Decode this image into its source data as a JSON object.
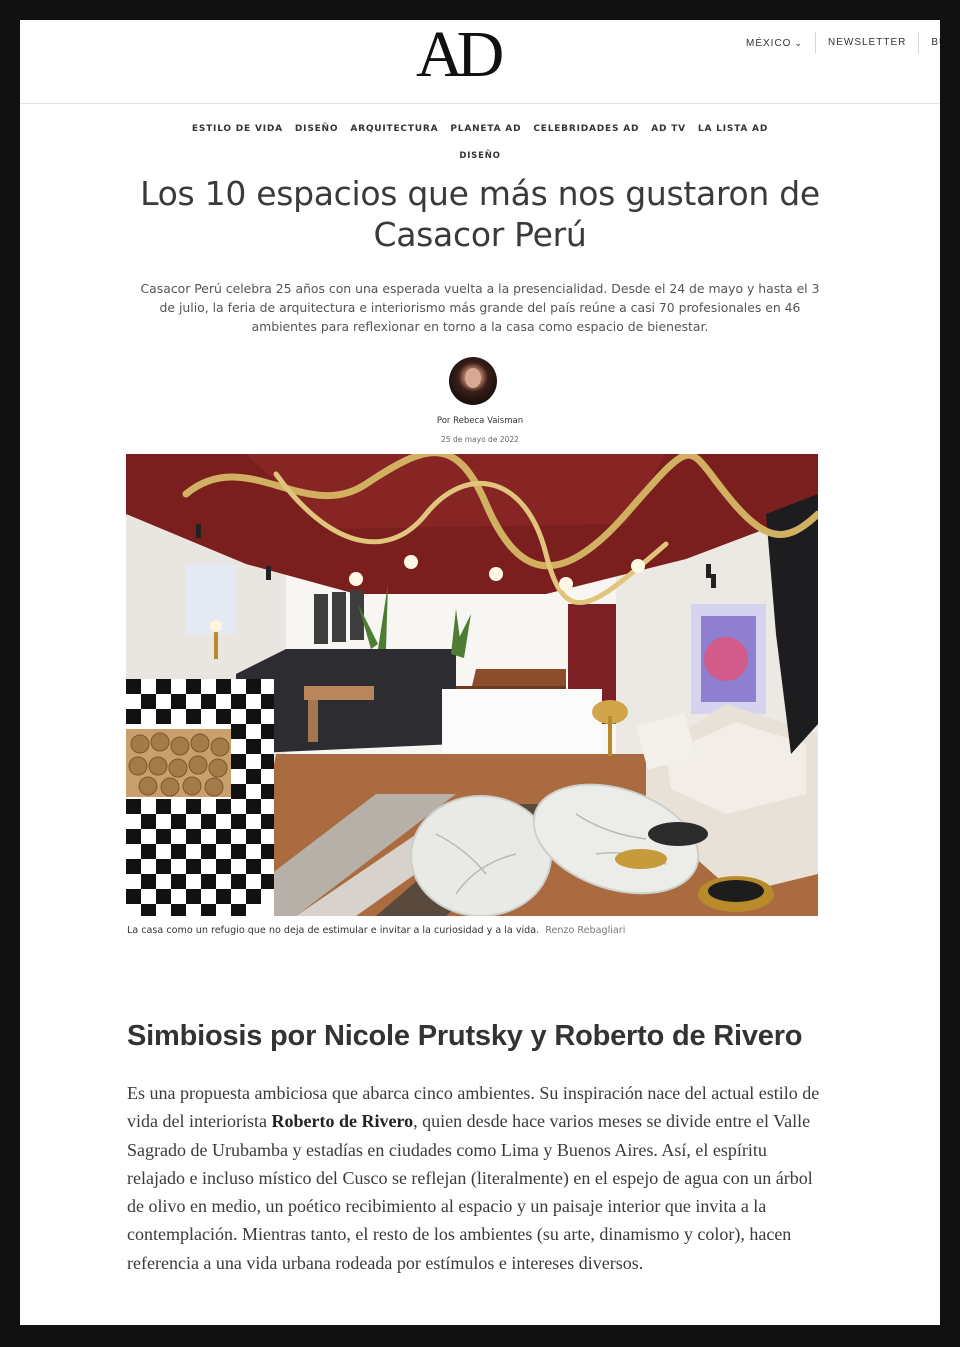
{
  "header": {
    "logo": "AD",
    "region_label": "MÉXICO",
    "newsletter_label": "NEWSLETTER",
    "search_label": "BUSC"
  },
  "nav": [
    "ESTILO DE VIDA",
    "DISEÑO",
    "ARQUITECTURA",
    "PLANETA AD",
    "CELEBRIDADES AD",
    "AD TV",
    "LA LISTA AD"
  ],
  "article": {
    "kicker": "DISEÑO",
    "title": "Los 10 espacios que más nos gustaron de Casacor Perú",
    "dek": "Casacor Perú celebra 25 años con una esperada vuelta a la presencialidad. Desde el 24 de mayo y hasta el 3 de julio, la feria de arquitectura e interiorismo más grande del país reúne a casi 70 profesionales en 46 ambientes para reflexionar en torno a la casa como espacio de bienestar.",
    "byline": "Por Rebeca Vaisman",
    "date": "25 de mayo de 2022",
    "caption": "La casa como un refugio que no deja de estimular e invitar a la curiosidad y a la vida.",
    "photo_credit": "Renzo Rebagliari",
    "section_heading": "Simbiosis por Nicole Prutsky y Roberto de Rivero",
    "body_before": "Es una propuesta ambiciosa que abarca cinco ambientes. Su inspiración nace del actual estilo de vida del interiorista ",
    "body_bold": "Roberto de Rivero",
    "body_after": ", quien desde hace varios meses se divide entre el Valle Sagrado de Urubamba y estadías en ciudades como Lima y Buenos Aires. Así, el espíritu relajado e incluso místico del Cusco se reflejan (literalmente) en el espejo de agua con un árbol de olivo en medio, un poético recibimiento al espacio y un paisaje interior que invita a la contemplación. Mientras tanto, el resto de los ambientes (su arte, dinamismo y color), hacen referencia a una vida urbana rodeada por estímulos e intereses diversos."
  },
  "colors": {
    "ceiling": "#7a1e1e",
    "brass": "#c9a24a",
    "text": "#333333",
    "frame": "#111111"
  }
}
